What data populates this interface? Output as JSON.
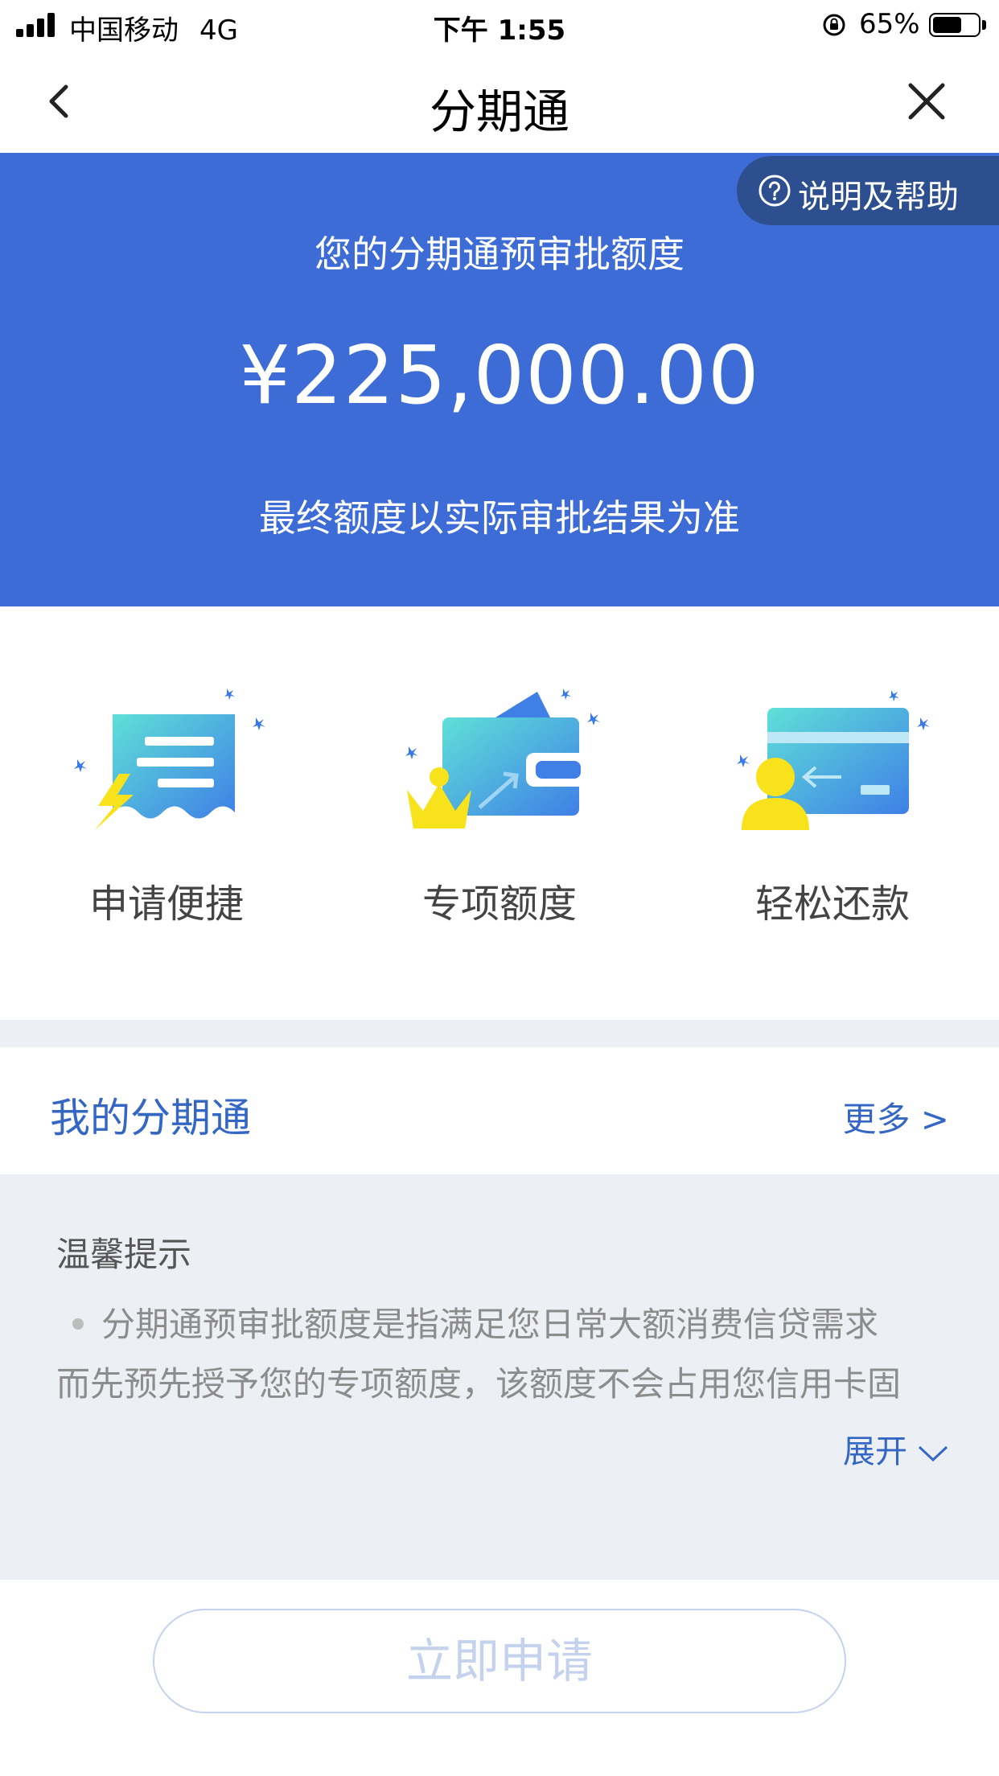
{
  "status_bar": {
    "carrier": "中国移动",
    "network": "4G",
    "time": "下午 1:55",
    "battery_percent": "65%",
    "battery_level": 0.65,
    "icons": [
      "signal-icon",
      "rotation-lock-icon",
      "battery-icon"
    ]
  },
  "nav": {
    "title": "分期通",
    "back_icon": "chevron-left-icon",
    "close_icon": "close-icon"
  },
  "hero": {
    "help_label": "说明及帮助",
    "title": "您的分期通预审批额度",
    "amount": "¥225,000.00",
    "note": "最终额度以实际审批结果为准",
    "background_color": "#3d6cd6"
  },
  "features": [
    {
      "label": "申请便捷",
      "icon": "quick-apply-icon"
    },
    {
      "label": "专项额度",
      "icon": "wallet-crown-icon"
    },
    {
      "label": "轻松还款",
      "icon": "card-repay-icon"
    }
  ],
  "my_section": {
    "title": "我的分期通",
    "more": "更多 >"
  },
  "tips": {
    "title": "温馨提示",
    "line1": "分期通预审批额度是指满足您日常大额消费信贷需求",
    "line2": "而先预先授予您的专项额度，该额度不会占用您信用卡固",
    "expand": "展开"
  },
  "apply_button": {
    "label": "立即申请"
  },
  "colors": {
    "accent": "#3466c4",
    "hero_blue": "#3d6cd6",
    "help_pill": "#2d4f8f"
  }
}
